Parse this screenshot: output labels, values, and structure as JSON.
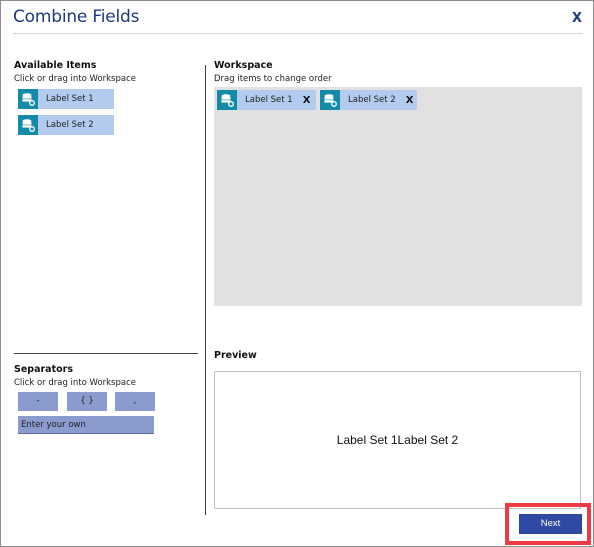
{
  "dialog": {
    "title": "Combine Fields",
    "close_label": "X"
  },
  "available": {
    "heading": "Available Items",
    "hint": "Click or drag into Workspace",
    "items": [
      {
        "label": "Label Set 1",
        "icon": "database-settings-icon"
      },
      {
        "label": "Label Set 2",
        "icon": "database-settings-icon"
      }
    ]
  },
  "workspace": {
    "heading": "Workspace",
    "hint": "Drag items to change order",
    "items": [
      {
        "label": "Label Set 1",
        "icon": "database-settings-icon",
        "remove_label": "X"
      },
      {
        "label": "Label Set 2",
        "icon": "database-settings-icon",
        "remove_label": "X"
      }
    ]
  },
  "separators": {
    "heading": "Separators",
    "hint": "Click or drag into Workspace",
    "options": [
      "-",
      "{ }",
      ","
    ],
    "custom_label": "Enter your own"
  },
  "preview": {
    "heading": "Preview",
    "text": "Label Set 1Label Set 2"
  },
  "footer": {
    "next_label": "Next"
  },
  "colors": {
    "accent": "#2f4aa3",
    "title": "#1f3a7a",
    "item_bg": "#b3cbef",
    "icon_bg": "#138aa8",
    "separator_bg": "#8b9bce",
    "workspace_bg": "#e1e1e1",
    "highlight": "#ee3a43"
  }
}
